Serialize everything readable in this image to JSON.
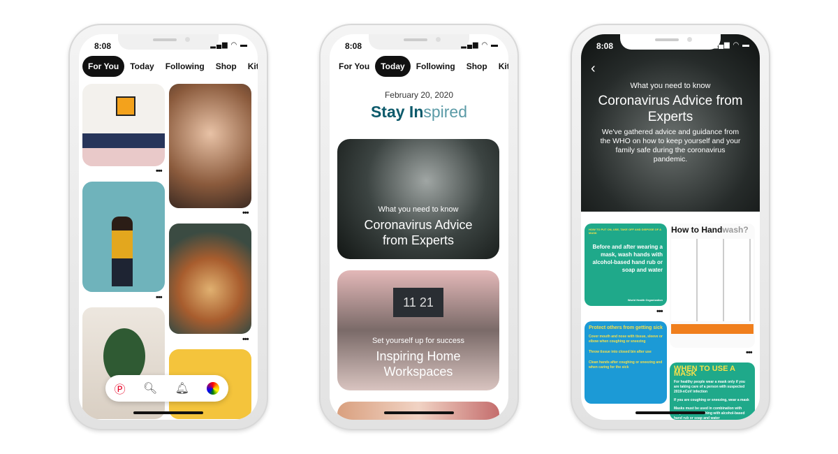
{
  "status": {
    "time": "8:08",
    "icons": [
      "signal-icon",
      "wifi-icon",
      "battery-icon"
    ]
  },
  "tabs": [
    "For You",
    "Today",
    "Following",
    "Shop",
    "Kitch"
  ],
  "phone1": {
    "nav": [
      "pinterest-logo-icon",
      "search-icon",
      "bell-icon",
      "avatar"
    ]
  },
  "phone2": {
    "date": "February 20, 2020",
    "title_bold": "Stay In",
    "title_light": "spired",
    "cards": [
      {
        "subtitle": "What you need to know",
        "title": "Coronavirus Advice from Experts"
      },
      {
        "subtitle": "Set yourself up for success",
        "title": "Inspiring Home Workspaces",
        "clock": "11 21"
      }
    ]
  },
  "phone3": {
    "subtitle": "What you need to know",
    "title": "Coronavirus Advice from Experts",
    "description": "We've gathered advice and guidance from the WHO on how to keep yourself and your family safe during the coronavirus pandemic.",
    "pins": {
      "mask_header": "HOW TO PUT ON, USE, TAKE OFF AND DISPOSE OF A MASK",
      "mask_text": "Before and after wearing a mask, wash hands with alcohol-based hand rub or soap and water",
      "handwash_title_bold": "How to Hand",
      "handwash_title_light": "wash?",
      "protect_title": "Protect others from getting sick",
      "protect_items": [
        "Cover mouth and nose with tissue, sleeve or elbow when coughing or sneezing",
        "Throw tissue into closed bin after use",
        "Clean hands after coughing or sneezing and when caring for the sick"
      ],
      "when_title": "WHEN TO USE A MASK",
      "when_items": [
        "For healthy people wear a mask only if you are taking care of a person with suspected 2019-nCoV infection",
        "If you are coughing or sneezing, wear a mask",
        "Masks must be used in combination with frequent hand-washing with alcohol-based hand rub or soap and water"
      ],
      "who": "World Health Organization"
    }
  },
  "colors": {
    "teal": "#1fa98a",
    "blue": "#1c9ad6",
    "title": "#0d5a6b",
    "orange": "#f07f1d"
  }
}
